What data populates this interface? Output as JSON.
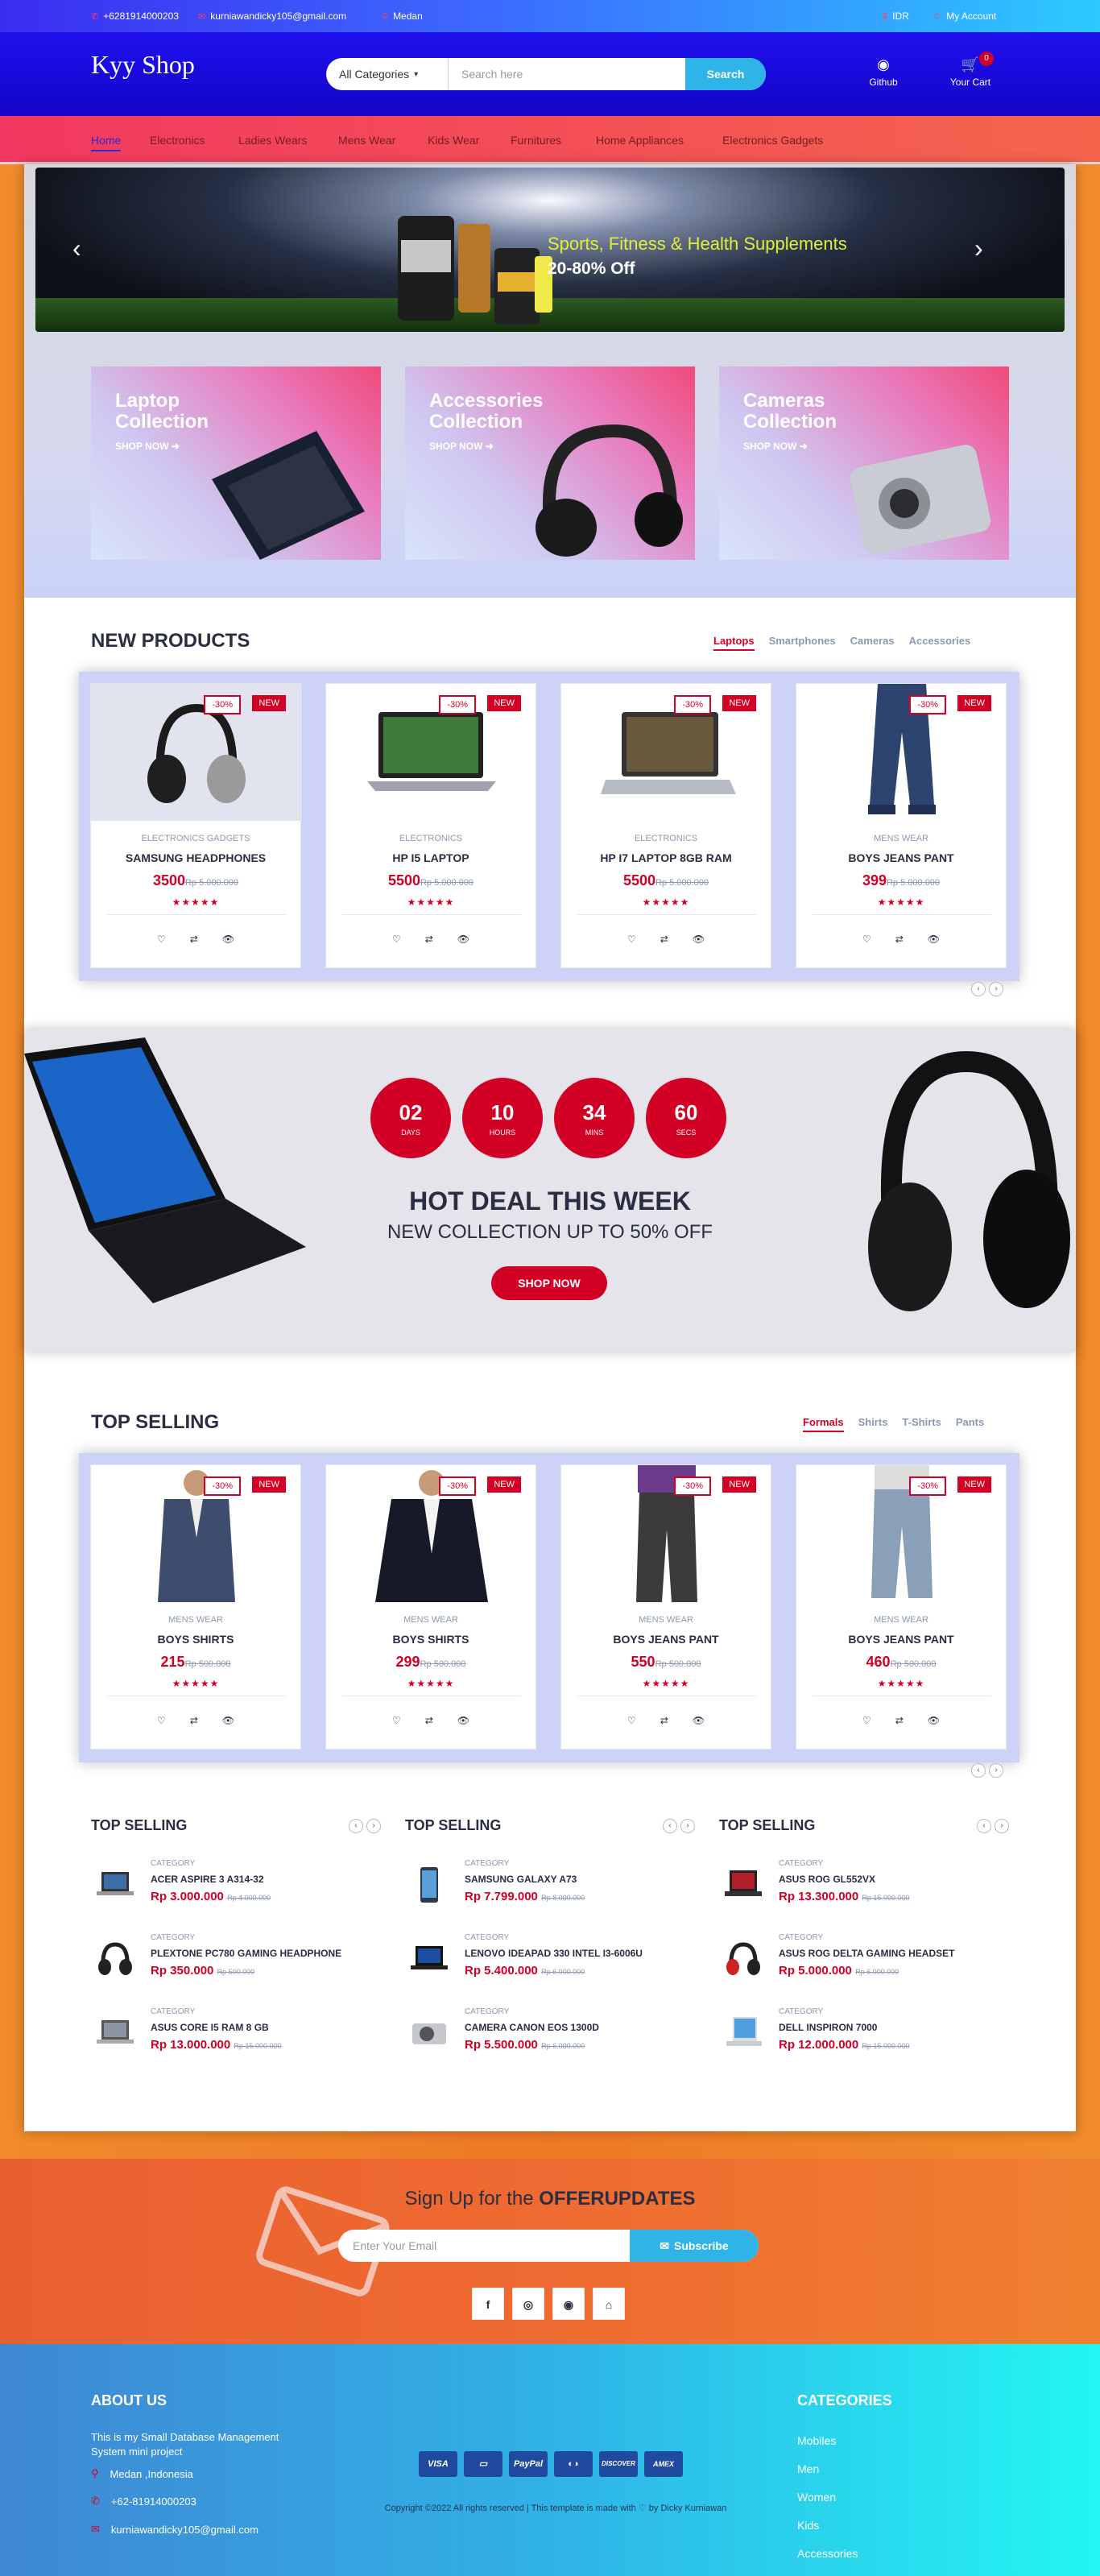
{
  "topbar": {
    "phone": "+6281914000203",
    "email": "kurniawandicky105@gmail.com",
    "location": "Medan",
    "currency": "IDR",
    "account": "My Account"
  },
  "header": {
    "logo": "Kyy Shop",
    "category_select": "All Categories",
    "search_placeholder": "Search here",
    "search_button": "Search",
    "github_label": "Github",
    "cart_label": "Your Cart",
    "cart_count": "0"
  },
  "nav": [
    "Home",
    "Electronics",
    "Ladies Wears",
    "Mens Wear",
    "Kids Wear",
    "Furnitures",
    "Home Appliances",
    "Electronics Gadgets"
  ],
  "slider": {
    "line1": "Sports, Fitness & Health Supplements",
    "line2": "20-80% Off",
    "prev": "‹",
    "next": "›"
  },
  "collections": [
    {
      "title1": "Laptop",
      "title2": "Collection",
      "cta": "SHOP NOW ➜"
    },
    {
      "title1": "Accessories",
      "title2": "Collection",
      "cta": "SHOP NOW ➜"
    },
    {
      "title1": "Cameras",
      "title2": "Collection",
      "cta": "SHOP NOW ➜"
    }
  ],
  "new_products": {
    "title": "NEW PRODUCTS",
    "tabs": [
      "Laptops",
      "Smartphones",
      "Cameras",
      "Accessories"
    ],
    "items": [
      {
        "category": "Electronics Gadgets",
        "name": "Samsung Headphones",
        "price": "3500",
        "old": "Rp 5.000.000",
        "discount": "-30%",
        "badge": "NEW",
        "image": "headphones-icon"
      },
      {
        "category": "Electronics",
        "name": "HP i5 laptop",
        "price": "5500",
        "old": "Rp 5.000.000",
        "discount": "-30%",
        "badge": "NEW",
        "image": "laptop-icon"
      },
      {
        "category": "Electronics",
        "name": "HP i7 laptop 8gb ram",
        "price": "5500",
        "old": "Rp 5.000.000",
        "discount": "-30%",
        "badge": "NEW",
        "image": "laptop-icon"
      },
      {
        "category": "Mens Wear",
        "name": "Boys Jeans Pant",
        "price": "399",
        "old": "Rp 5.000.000",
        "discount": "-30%",
        "badge": "NEW",
        "image": "jeans-icon"
      }
    ]
  },
  "ratings": "★★★★★",
  "actions": {
    "wish": "♡",
    "compare": "⇄",
    "view": "👁"
  },
  "pager": {
    "prev": "‹",
    "next": "›"
  },
  "hot_deal": {
    "countdown": [
      {
        "value": "02",
        "label": "Days"
      },
      {
        "value": "10",
        "label": "Hours"
      },
      {
        "value": "34",
        "label": "Mins"
      },
      {
        "value": "60",
        "label": "Secs"
      }
    ],
    "title": "HOT DEAL THIS WEEK",
    "subtitle": "New Collection Up to 50% OFF",
    "button": "Shop now"
  },
  "top_selling": {
    "title": "TOP SELLING",
    "tabs": [
      "Formals",
      "Shirts",
      "T-Shirts",
      "Pants"
    ],
    "items": [
      {
        "category": "Mens Wear",
        "name": "Boys Shirts",
        "price": "215",
        "old": "Rp 500.000",
        "discount": "-30%",
        "badge": "NEW"
      },
      {
        "category": "Mens Wear",
        "name": "Boys Shirts",
        "price": "299",
        "old": "Rp 500.000",
        "discount": "-30%",
        "badge": "NEW"
      },
      {
        "category": "Mens Wear",
        "name": "Boys Jeans Pant",
        "price": "550",
        "old": "Rp 500.000",
        "discount": "-30%",
        "badge": "NEW"
      },
      {
        "category": "Mens Wear",
        "name": "Boys Jeans Pant",
        "price": "460",
        "old": "Rp 500.000",
        "discount": "-30%",
        "badge": "NEW"
      }
    ]
  },
  "widgets": [
    {
      "title": "TOP SELLING",
      "items": [
        {
          "category": "Category",
          "name": "ACER ASPIRE 3 A314-32",
          "price": "Rp 3.000.000",
          "old": "Rp 4.000.000"
        },
        {
          "category": "Category",
          "name": "PLEXTONE PC780 GAMING HEADPHONE",
          "price": "Rp 350.000",
          "old": "Rp 500.000"
        },
        {
          "category": "Category",
          "name": "ASUS CORE I5 RAM 8 GB",
          "price": "Rp 13.000.000",
          "old": "Rp 15.000.000"
        }
      ]
    },
    {
      "title": "TOP SELLING",
      "items": [
        {
          "category": "Category",
          "name": "SAMSUNG GALAXY A73",
          "price": "Rp 7.799.000",
          "old": "Rp 8.000.000"
        },
        {
          "category": "Category",
          "name": "LENOVO IDEAPAD 330 INTEL I3-6006U",
          "price": "Rp 5.400.000",
          "old": "Rp 6.000.000"
        },
        {
          "category": "Category",
          "name": "CAMERA CANON EOS 1300D",
          "price": "Rp 5.500.000",
          "old": "Rp 6.000.000"
        }
      ]
    },
    {
      "title": "TOP SELLING",
      "items": [
        {
          "category": "Category",
          "name": "ASUS ROG GL552VX",
          "price": "Rp 13.300.000",
          "old": "Rp 15.000.000"
        },
        {
          "category": "Category",
          "name": "ASUS ROG DELTA GAMING HEADSET",
          "price": "Rp 5.000.000",
          "old": "Rp 6.000.000"
        },
        {
          "category": "Category",
          "name": "DELL INSPIRON 7000",
          "price": "Rp 12.000.000",
          "old": "Rp 15.000.000"
        }
      ]
    }
  ],
  "newsletter": {
    "title_prefix": "Sign Up for the ",
    "title_bold": "OFFERUPDATES",
    "placeholder": "Enter Your Email",
    "button": "Subscribe",
    "socials": [
      "f",
      "◎",
      "◉",
      "⌂"
    ]
  },
  "footer": {
    "about_title": "ABOUT US",
    "about_text": "This is my Small Database Management System mini project",
    "address": "Medan ,Indonesia",
    "phone": "+62-81914000203",
    "email": "kurniawandicky105@gmail.com",
    "cards": [
      "VISA",
      "▭",
      "PayPal",
      "◐◑",
      "DISCOVER",
      "AMEX"
    ],
    "copyright": "Copyright ©2022 All rights reserved | This template is made with ♡ by Dicky Kurniawan",
    "categories_title": "CATEGORIES",
    "categories": [
      "Mobiles",
      "Men",
      "Women",
      "Kids",
      "Accessories"
    ]
  },
  "colors": {
    "accent": "#d10024",
    "header": "#1f10ee",
    "nav": "#f23860",
    "search_button": "#2eb4e6"
  }
}
